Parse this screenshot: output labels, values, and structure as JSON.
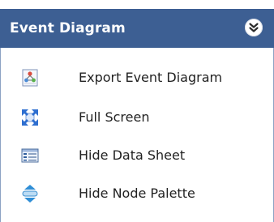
{
  "panel": {
    "title": "Event Diagram",
    "collapse_icon": "double-chevron-down-icon"
  },
  "menu": {
    "items": [
      {
        "label": "Export Event Diagram",
        "icon": "export-diagram-icon"
      },
      {
        "label": "Full Screen",
        "icon": "fullscreen-arrows-icon"
      },
      {
        "label": "Hide Data Sheet",
        "icon": "data-sheet-icon"
      },
      {
        "label": "Hide Node Palette",
        "icon": "node-palette-icon"
      }
    ]
  },
  "colors": {
    "header_background": "#3d5f93",
    "header_text": "#ffffff",
    "border": "#8da2c4",
    "item_text": "#222222"
  }
}
